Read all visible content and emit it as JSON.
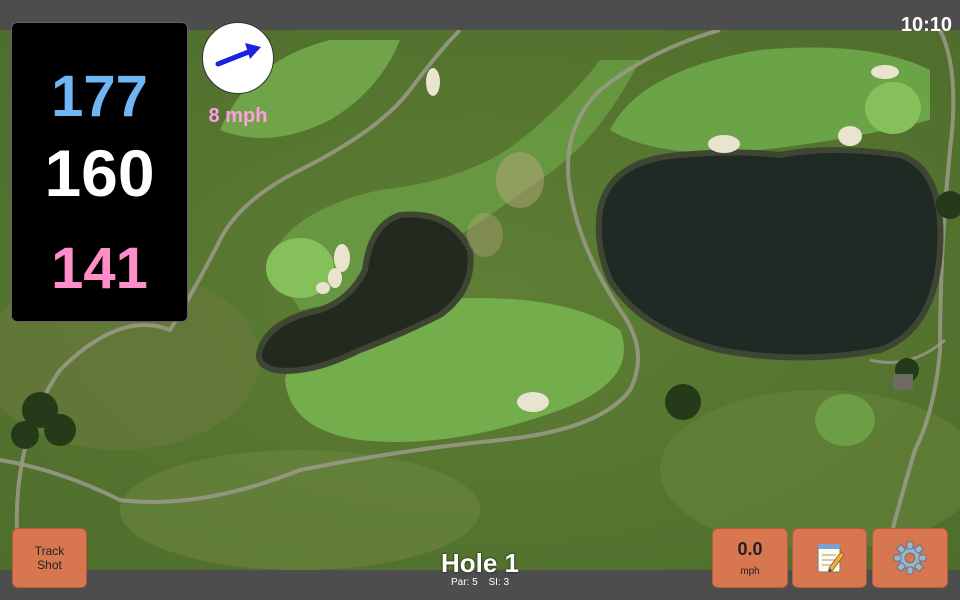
{
  "status": {
    "time": "10:10"
  },
  "distances": {
    "back": "177",
    "center": "160",
    "front": "141"
  },
  "wind": {
    "speed": "8 mph",
    "direction_icon": "arrow-up-right-icon"
  },
  "buttons": {
    "track_shot": "Track Shot",
    "speed_value": "0.0",
    "speed_unit": "mph",
    "notes_icon": "notepad-icon",
    "settings_icon": "gear-icon"
  },
  "hole": {
    "title": "Hole 1",
    "par": "Par: 5",
    "si": "SI: 3"
  },
  "colors": {
    "back_distance": "#6fb6f5",
    "center_distance": "#ffffff",
    "front_distance": "#ff8ec8",
    "wind_text": "#ff9fe0",
    "button": "#d8764f",
    "arrow": "#1a22e0"
  }
}
